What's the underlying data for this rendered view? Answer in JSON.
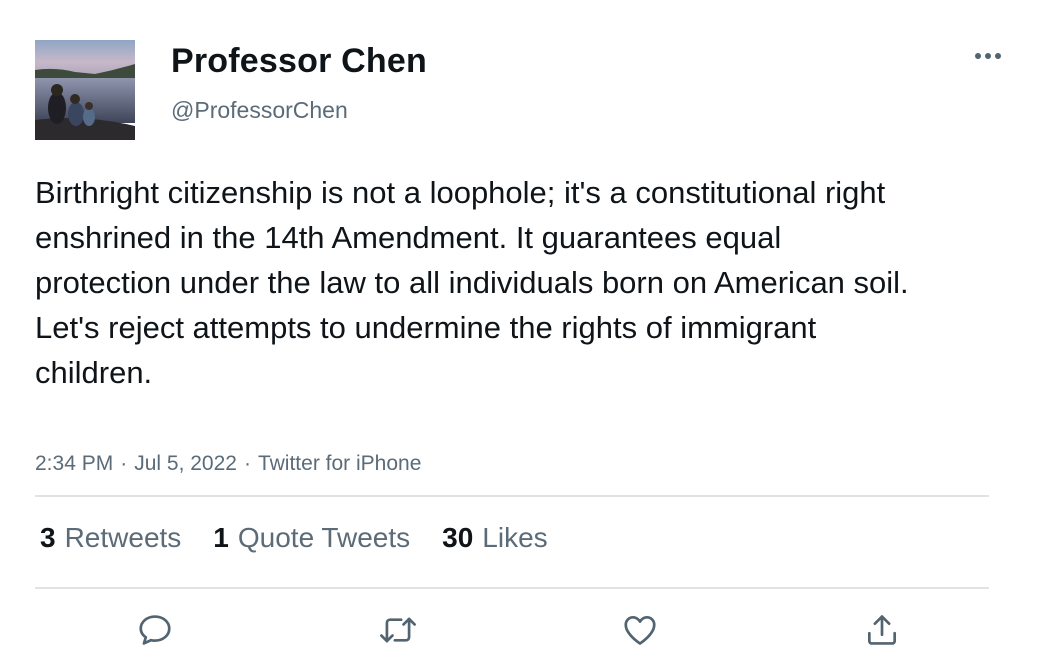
{
  "author": {
    "display_name": "Professor Chen",
    "handle": "@ProfessorChen"
  },
  "tweet": {
    "text": "Birthright citizenship is not a loophole; it's a constitutional right enshrined in the 14th Amendment. It guarantees equal protection under the law to all individuals born on American soil. Let's reject attempts to undermine the rights of immigrant children.",
    "time": "2:34 PM",
    "date": "Jul 5, 2022",
    "source": "Twitter for iPhone",
    "separator": "·"
  },
  "stats": {
    "retweets_count": "3",
    "retweets_label": "Retweets",
    "quotes_count": "1",
    "quotes_label": "Quote Tweets",
    "likes_count": "30",
    "likes_label": "Likes"
  },
  "icons": {
    "more": "more-icon",
    "reply": "reply-icon",
    "retweet": "retweet-icon",
    "like": "heart-icon",
    "share": "share-icon"
  },
  "colors": {
    "text": "#0f1419",
    "secondary": "#5b6b78",
    "divider": "#dfe3e6",
    "icon": "#536471"
  }
}
